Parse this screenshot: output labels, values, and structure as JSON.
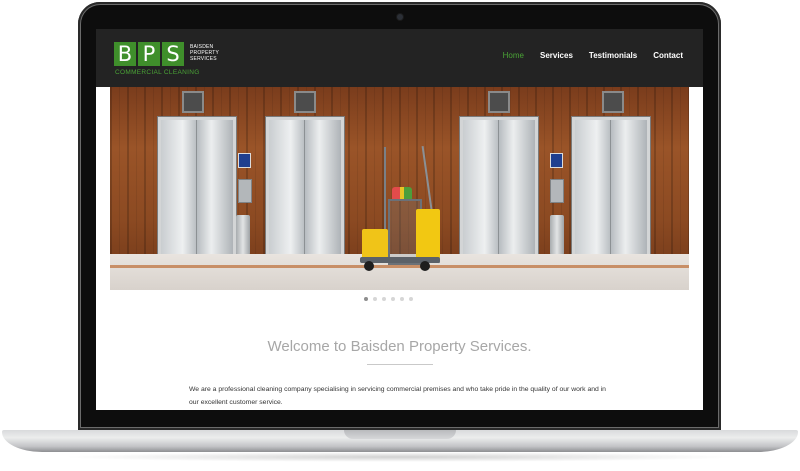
{
  "header": {
    "logo_letters": [
      "B",
      "P",
      "S"
    ],
    "logo_name_lines": [
      "BAISDEN",
      "PROPERTY",
      "SERVICES"
    ],
    "logo_tagline": "COMMERCIAL CLEANING"
  },
  "nav": {
    "items": [
      {
        "label": "Home",
        "active": true
      },
      {
        "label": "Services",
        "active": false
      },
      {
        "label": "Testimonials",
        "active": false
      },
      {
        "label": "Contact",
        "active": false
      }
    ]
  },
  "slider": {
    "slide_count": 6,
    "active_index": 0
  },
  "welcome": {
    "title": "Welcome to Baisden Property Services.",
    "body": "We are a professional cleaning company specialising in servicing commercial premises and who take pride in the quality of our work and in our excellent customer service."
  },
  "colors": {
    "brand_green": "#3f8f2b",
    "active_nav": "#4aa336",
    "header_bg": "#232323"
  }
}
